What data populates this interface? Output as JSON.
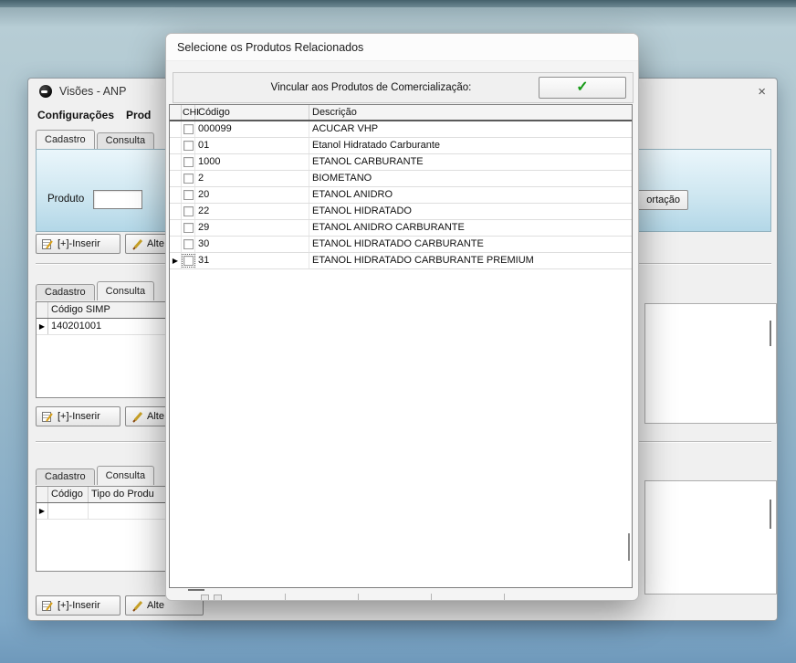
{
  "icons": {
    "close": "×",
    "check": "✓"
  },
  "window": {
    "title": "Visões - ANP",
    "main_tabs": [
      {
        "label": "Configurações"
      },
      {
        "label": "Prod"
      }
    ],
    "buttons": {
      "insert": "[+]-Inserir",
      "alter": "Alte"
    },
    "section1": {
      "tabs": [
        {
          "label": "Cadastro",
          "active": true
        },
        {
          "label": "Consulta",
          "active": false
        }
      ],
      "produto_label": "Produto",
      "produto_value": "",
      "partial_button": "ortação"
    },
    "section2": {
      "tabs": [
        {
          "label": "Cadastro",
          "active": false
        },
        {
          "label": "Consulta",
          "active": true
        }
      ],
      "columns": [
        "Código SIMP"
      ],
      "rows": [
        {
          "codigo_simp": "140201001",
          "selected": true
        }
      ]
    },
    "section3": {
      "tabs": [
        {
          "label": "Cadastro",
          "active": false
        },
        {
          "label": "Consulta",
          "active": true
        }
      ],
      "columns": [
        "Código",
        "Tipo do Produ"
      ],
      "rows": [
        {
          "codigo": "",
          "tipo": "",
          "selected": true
        }
      ]
    }
  },
  "dialog": {
    "title": "Selecione os Produtos Relacionados",
    "toolbar": {
      "label": "Vincular aos Produtos de Comercialização:"
    },
    "grid": {
      "columns": [
        "CHI",
        "Código",
        "Descrição"
      ],
      "rows": [
        {
          "checked": false,
          "codigo": "000099",
          "descricao": "ACUCAR VHP"
        },
        {
          "checked": false,
          "codigo": "01",
          "descricao": "Etanol Hidratado Carburante"
        },
        {
          "checked": false,
          "codigo": "1000",
          "descricao": "ETANOL CARBURANTE"
        },
        {
          "checked": false,
          "codigo": "2",
          "descricao": "BIOMETANO"
        },
        {
          "checked": false,
          "codigo": "20",
          "descricao": "ETANOL ANIDRO"
        },
        {
          "checked": false,
          "codigo": "22",
          "descricao": "ETANOL HIDRATADO"
        },
        {
          "checked": false,
          "codigo": "29",
          "descricao": "ETANOL ANIDRO CARBURANTE"
        },
        {
          "checked": false,
          "codigo": "30",
          "descricao": "ETANOL HIDRATADO CARBURANTE"
        },
        {
          "checked": false,
          "codigo": "31",
          "descricao": "ETANOL HIDRATADO CARBURANTE PREMIUM",
          "selected": true
        }
      ]
    }
  }
}
